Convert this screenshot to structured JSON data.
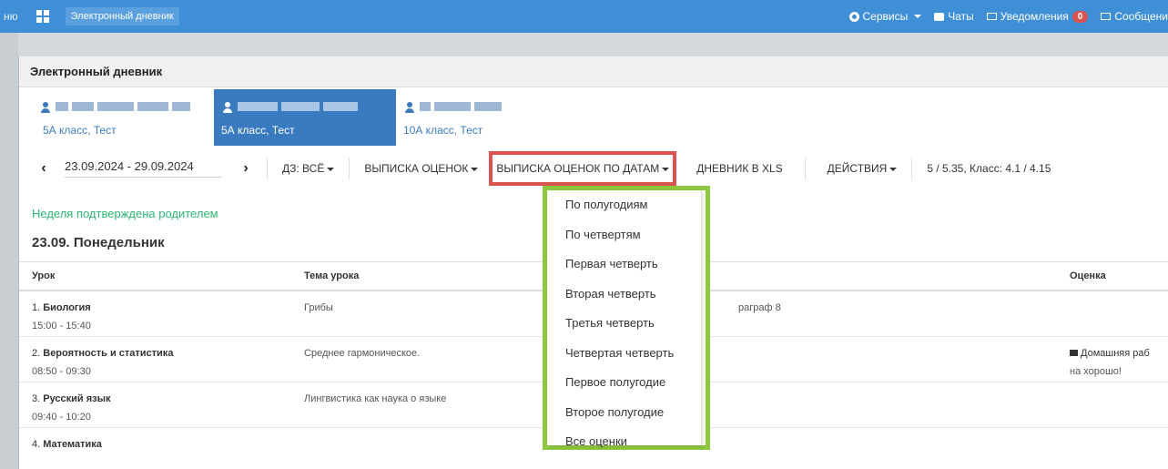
{
  "navbar": {
    "left_text": "ню",
    "brand": "Электронный дневник",
    "services": "Сервисы",
    "chats": "Чаты",
    "notifications": "Уведомления",
    "notifications_count": "0",
    "messages": "Сообщени"
  },
  "panel": {
    "title": "Электронный дневник"
  },
  "students": [
    {
      "class": "5А класс, Тест",
      "active": false
    },
    {
      "class": "5А класс, Тест",
      "active": true
    },
    {
      "class": "10А класс, Тест",
      "active": false
    }
  ],
  "toolbar": {
    "date_range": "23.09.2024 - 29.09.2024",
    "homework": "ДЗ: ВСЁ",
    "grades_report": "ВЫПИСКА ОЦЕНОК",
    "grades_by_dates": "ВЫПИСКА ОЦЕНОК ПО ДАТАМ",
    "diary_xls": "ДНЕВНИК В XLS",
    "actions": "ДЕЙСТВИЯ",
    "stats": "5 / 5.35, Класс: 4.1 / 4.15"
  },
  "week_confirmed": "Неделя подтверждена родителем",
  "day_title": "23.09. Понедельник",
  "table": {
    "headers": {
      "lesson": "Урок",
      "topic": "Тема урока",
      "grade": "Оценка"
    },
    "rows": [
      {
        "num": "1.",
        "subject": "Биология",
        "time": "15:00 - 15:40",
        "topic": "Грибы",
        "homework": "раграф 8",
        "grade_line1": "",
        "grade_line2": ""
      },
      {
        "num": "2.",
        "subject": "Вероятность и статистика",
        "time": "08:50 - 09:30",
        "topic": "Среднее гармоническое.",
        "homework": "",
        "grade_line1": "Домашняя раб",
        "grade_line2": "на хорошо!"
      },
      {
        "num": "3.",
        "subject": "Русский язык",
        "time": "09:40 - 10:20",
        "topic": "Лингвистика как наука о языке",
        "homework": "",
        "grade_line1": "",
        "grade_line2": ""
      },
      {
        "num": "4.",
        "subject": "Математика",
        "time": "",
        "topic": "",
        "homework": "",
        "grade_line1": "",
        "grade_line2": ""
      }
    ]
  },
  "dropdown": {
    "items": [
      "По полугодиям",
      "По четвертям",
      "Первая четверть",
      "Вторая четверть",
      "Третья четверть",
      "Четвертая четверть",
      "Первое полугодие",
      "Второе полугодие",
      "Все оценки"
    ]
  },
  "colors": {
    "navbar": "#3e8fd6",
    "active_student": "#3a7bbf",
    "highlight_red": "#d9534f",
    "highlight_green": "#8dc63f",
    "confirmed_green": "#2cb573"
  }
}
